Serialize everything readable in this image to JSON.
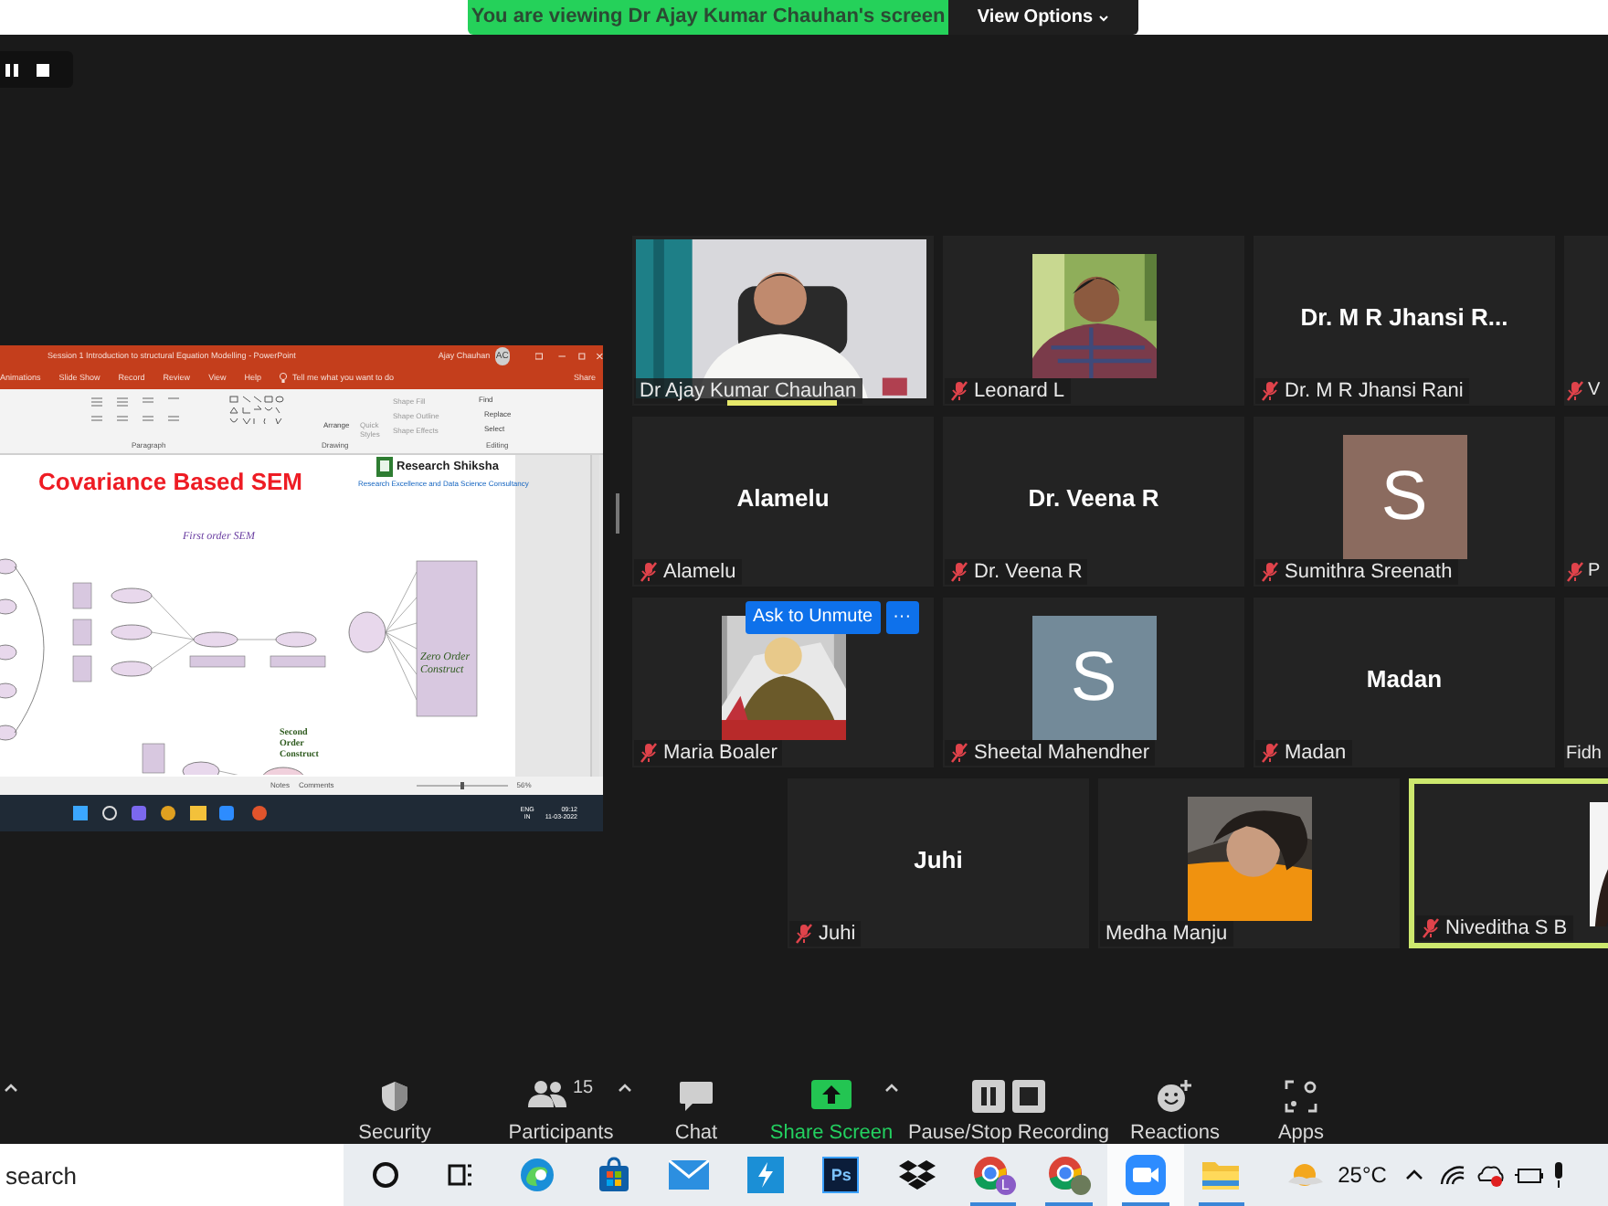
{
  "banner": {
    "text": "You are viewing Dr Ajay Kumar Chauhan's screen",
    "button": "View Options"
  },
  "shared_screen": {
    "title": "Session 1 Introduction to structural Equation Modelling  -  PowerPoint",
    "user": "Ajay Chauhan",
    "user_initials": "AC",
    "menu": [
      "Animations",
      "Slide Show",
      "Record",
      "Review",
      "View",
      "Help"
    ],
    "tell_me": "Tell me what you want to do",
    "share": "Share",
    "ribbon_groups": [
      "Paragraph",
      "Drawing",
      "Editing"
    ],
    "ribbon_commands": [
      "Arrange",
      "Quick Styles",
      "Shape Fill",
      "Shape Outline",
      "Shape Effects",
      "Find",
      "Replace",
      "Select"
    ],
    "slide": {
      "title": "Covariance Based SEM",
      "logo": "Research Shiksha",
      "logo_tagline": "Research Excellence and Data Science Consultancy",
      "labels": [
        {
          "kind": "first",
          "text": "First order SEM"
        },
        {
          "kind": "zero",
          "text": "Zero Order Construct"
        },
        {
          "kind": "second",
          "text": "Second Order Construct"
        }
      ]
    },
    "status": [
      "Notes",
      "Comments",
      "56%"
    ],
    "taskbar": {
      "language": "ENG",
      "region": "IN",
      "time": "09:12",
      "date": "11-03-2022"
    }
  },
  "tiles": [
    [
      {
        "kind": "video",
        "label": "Dr Ajay Kumar Chauhan",
        "muted": false,
        "speaking": true,
        "highlighted": false
      },
      {
        "label": "Leonard L",
        "muted": true,
        "speaking": false,
        "highlighted": false
      },
      {
        "kind": "name",
        "display": "Dr. M R Jhansi R...",
        "label": "Dr. M R Jhansi Rani",
        "muted": true,
        "speaking": false,
        "highlighted": false
      },
      {
        "kind": "cut",
        "label": "V",
        "muted": true,
        "speaking": false,
        "highlighted": false
      }
    ],
    [
      {
        "kind": "name",
        "display": "Alamelu",
        "label": "Alamelu",
        "muted": true,
        "speaking": false,
        "highlighted": false
      },
      {
        "kind": "name",
        "display": "Dr. Veena R",
        "label": "Dr. Veena R",
        "muted": true,
        "speaking": false,
        "highlighted": false
      },
      {
        "kind": "avatar",
        "letter": "S",
        "color": "#8b6b5f",
        "label": "Sumithra Sreenath",
        "muted": true,
        "speaking": false,
        "highlighted": false
      },
      {
        "kind": "cut",
        "label": "P",
        "muted": true,
        "speaking": false,
        "highlighted": false
      }
    ],
    [
      {
        "label": "Maria Boaler",
        "muted": true,
        "speaking": false,
        "highlighted": false,
        "actions": [
          "Ask to Unmute",
          "···"
        ]
      },
      {
        "kind": "avatar",
        "letter": "S",
        "color": "#738a99",
        "label": "Sheetal Mahendher",
        "muted": true,
        "speaking": false,
        "highlighted": false
      },
      {
        "kind": "name",
        "display": "Madan",
        "label": "Madan",
        "muted": true,
        "speaking": false,
        "highlighted": false
      },
      {
        "kind": "cut",
        "label": "Fidh",
        "muted": false,
        "speaking": false,
        "highlighted": false
      }
    ],
    [
      {
        "kind": "name",
        "display": "Juhi",
        "label": "Juhi",
        "muted": true,
        "speaking": false,
        "highlighted": false
      },
      {
        "label": "Medha Manju",
        "muted": false,
        "speaking": false,
        "highlighted": false
      },
      {
        "label": "Niveditha S B",
        "muted": true,
        "speaking": false,
        "highlighted": true
      }
    ]
  ],
  "toolbar": [
    {
      "kind": "security",
      "label": "Security"
    },
    {
      "kind": "participants",
      "label": "Participants",
      "count": "15"
    },
    {
      "kind": "chat",
      "label": "Chat"
    },
    {
      "kind": "share",
      "label": "Share Screen"
    },
    {
      "kind": "record",
      "label": "Pause/Stop Recording"
    },
    {
      "kind": "reactions",
      "label": "Reactions"
    },
    {
      "kind": "apps",
      "label": "Apps"
    }
  ],
  "taskbar": {
    "search_placeholder": "search",
    "apps": [
      {
        "kind": "cortana",
        "running": false,
        "active": false
      },
      {
        "kind": "taskview",
        "running": false,
        "active": false
      },
      {
        "kind": "edge",
        "running": false,
        "active": false
      },
      {
        "kind": "store",
        "running": false,
        "active": false
      },
      {
        "kind": "mail",
        "running": false,
        "active": false
      },
      {
        "kind": "sapp",
        "running": false,
        "active": false
      },
      {
        "kind": "photoshop",
        "text": "Ps",
        "running": false,
        "active": false
      },
      {
        "kind": "dropbox",
        "running": false,
        "active": false
      },
      {
        "kind": "chrome",
        "color": "#8a5cc7",
        "badge_letter": "L",
        "running": true,
        "active": false
      },
      {
        "kind": "chrome",
        "color": "#6b7b5a",
        "running": true,
        "active": false
      },
      {
        "kind": "zoom",
        "running": true,
        "active": true
      },
      {
        "kind": "explorer",
        "running": true,
        "active": false
      }
    ],
    "weather": "25°C"
  }
}
